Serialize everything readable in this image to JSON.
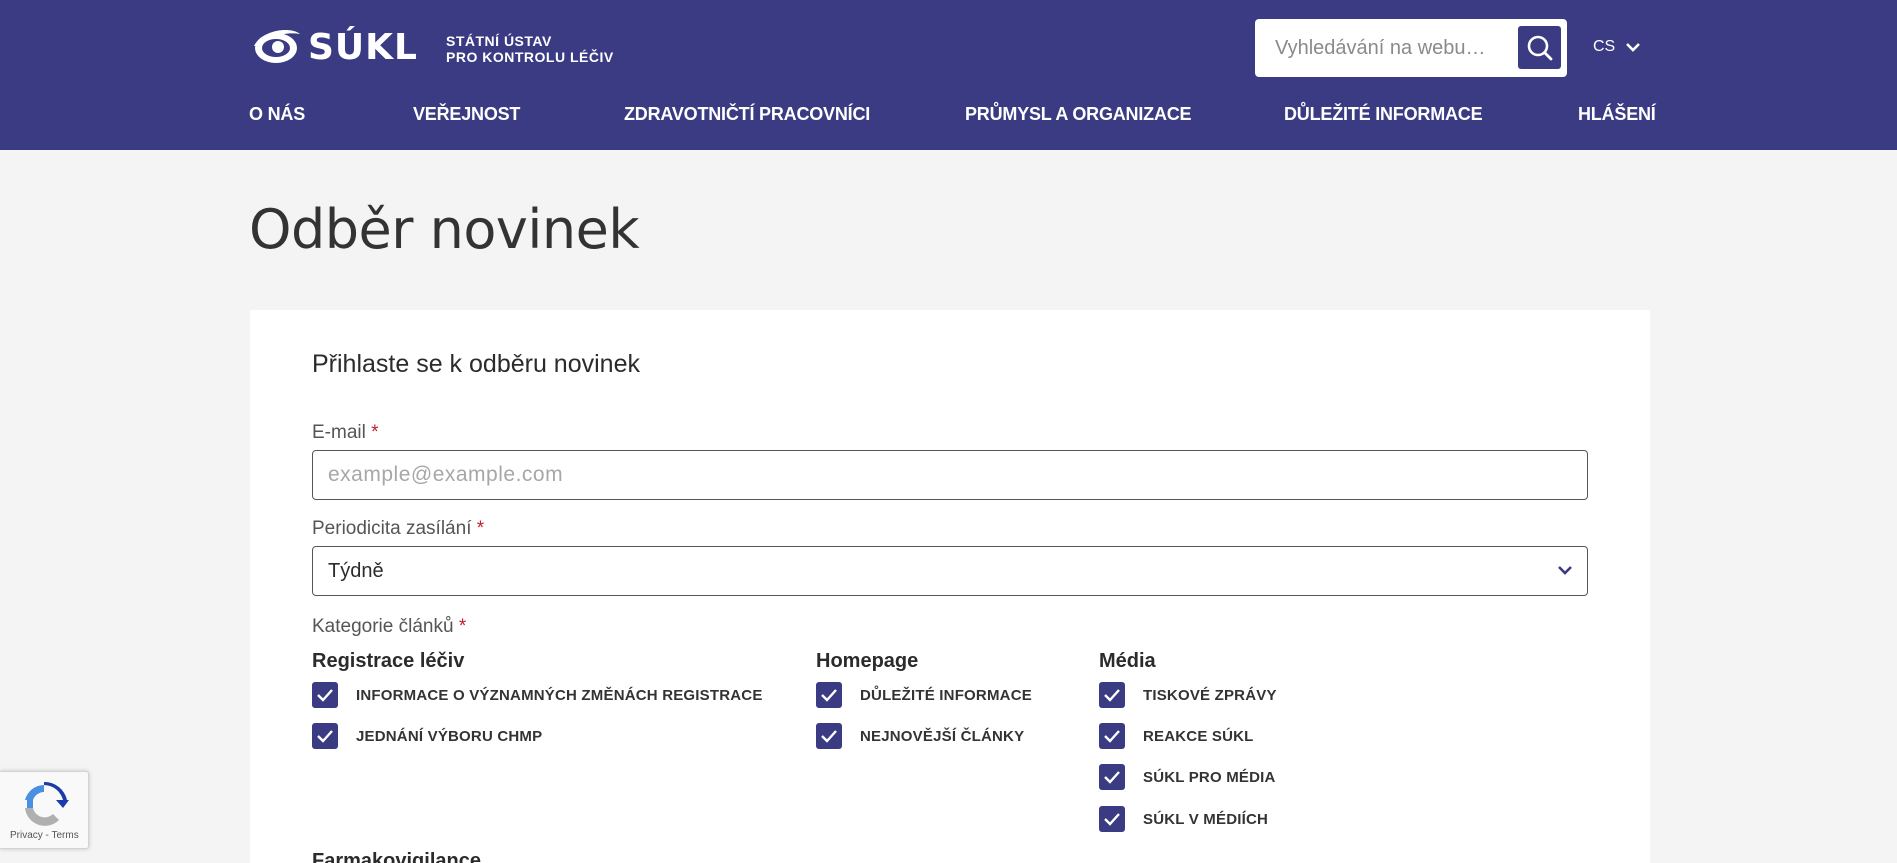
{
  "header": {
    "logo_text": "SÚKL",
    "logo_sub_line1": "STÁTNÍ ÚSTAV",
    "logo_sub_line2": "PRO KONTROLU LÉČIV",
    "search_placeholder": "Vyhledávání na webu…",
    "language": "CS",
    "nav": [
      "O NÁS",
      "VEŘEJNOST",
      "ZDRAVOTNIČTÍ PRACOVNÍCI",
      "PRŮMYSL A ORGANIZACE",
      "DŮLEŽITÉ INFORMACE",
      "HLÁŠENÍ"
    ]
  },
  "page": {
    "title": "Odběr novinek",
    "form_title": "Přihlaste se k odběru novinek",
    "required_mark": "*"
  },
  "form": {
    "email_label": "E-mail",
    "email_placeholder": "example@example.com",
    "frequency_label": "Periodicita zasílání",
    "frequency_value": "Týdně",
    "categories_label": "Kategorie článků",
    "groups": [
      {
        "title": "Registrace léčiv",
        "items": [
          "INFORMACE O VÝZNAMNÝCH ZMĚNÁCH REGISTRACE",
          "JEDNÁNÍ VÝBORU CHMP"
        ]
      },
      {
        "title": "Homepage",
        "items": [
          "DŮLEŽITÉ INFORMACE",
          "NEJNOVĚJŠÍ ČLÁNKY"
        ]
      },
      {
        "title": "Média",
        "items": [
          "TISKOVÉ ZPRÁVY",
          "REAKCE SÚKL",
          "SÚKL PRO MÉDIA",
          "SÚKL V MÉDIÍCH"
        ]
      }
    ],
    "next_group_title": "Farmakovigilance"
  },
  "recaptcha": {
    "links": "Privacy - Terms"
  },
  "colors": {
    "brand": "#3a3b83",
    "background": "#f4f4f4",
    "required": "#c0202a"
  }
}
